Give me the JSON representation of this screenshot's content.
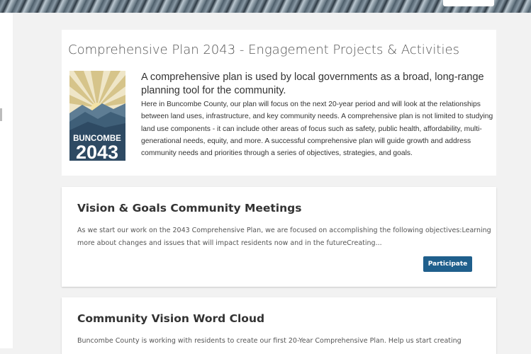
{
  "header": {
    "title": "Comprehensive Plan 2043 - Engagement Projects & Activities",
    "intro_lead": "A comprehensive plan is used by local governments as a broad, long-range planning tool for the community.",
    "intro_body": "Here in Buncombe County, our plan will focus on the next 20-year period and will look at the relationships between land uses, infrastructure, and key community needs. A comprehensive plan is not limited to studying land use components - it can include other areas of focus such as safety, public health, affordability, multi-generational needs, equity, and more. A successful comprehensive plan will guide growth and address community needs and priorities through a series of objectives, strategies, and goals.",
    "logo": {
      "line1": "BUNCOMBE",
      "line2": "2043"
    }
  },
  "projects": [
    {
      "title": "Vision & Goals Community Meetings",
      "description": "As we start our work on the 2043 Comprehensive Plan, we are focused on accomplishing the following objectives:Learning more about changes and issues that will impact residents now and in the futureCreating...",
      "button_label": "Participate"
    },
    {
      "title": "Community Vision Word Cloud",
      "description": "Buncombe County is working with residents to create our first 20-Year Comprehensive Plan. Help us start creating"
    }
  ],
  "colors": {
    "button": "#1f5f8c",
    "logo_sky": "#d9cc9e",
    "logo_mountain": "#2e4a63",
    "logo_text": "#ffffff"
  }
}
